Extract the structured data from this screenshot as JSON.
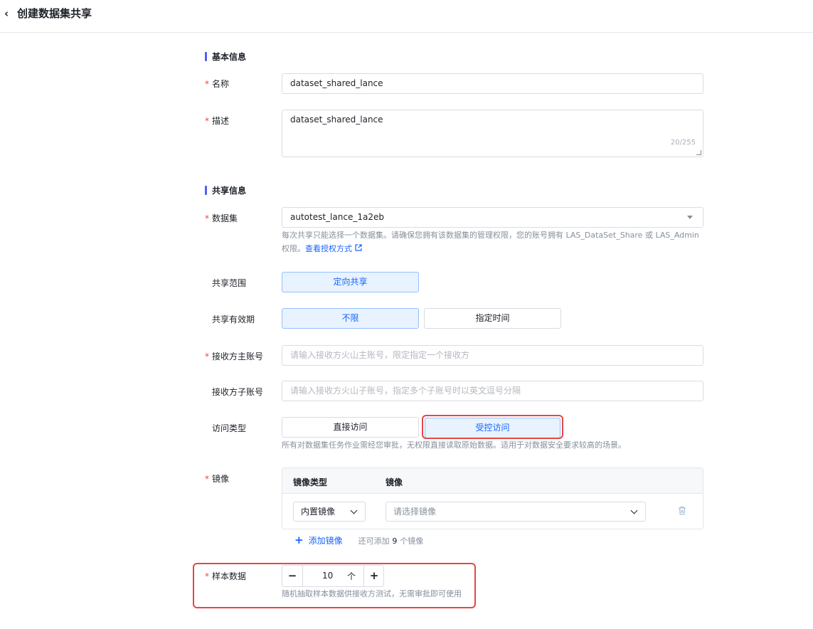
{
  "header": {
    "back_icon": "‹",
    "title": "创建数据集共享"
  },
  "sections": {
    "basic": "基本信息",
    "share": "共享信息"
  },
  "form": {
    "name": {
      "label": "名称",
      "value": "dataset_shared_lance"
    },
    "description": {
      "label": "描述",
      "value": "dataset_shared_lance",
      "counter": "20/255"
    },
    "dataset": {
      "label": "数据集",
      "value": "autotest_lance_1a2eb",
      "hint": "每次共享只能选择一个数据集。请确保您拥有该数据集的管理权限，您的账号拥有 LAS_DataSet_Share 或 LAS_Admin 权限。",
      "hint_link": "查看授权方式"
    },
    "share_scope": {
      "label": "共享范围",
      "option": "定向共享"
    },
    "validity": {
      "label": "共享有效期",
      "options": [
        "不限",
        "指定时间"
      ],
      "selected": "不限"
    },
    "main_account": {
      "label": "接收方主账号",
      "placeholder": "请输入接收方火山主账号，限定指定一个接收方"
    },
    "sub_account": {
      "label": "接收方子账号",
      "placeholder": "请输入接收方火山子账号，指定多个子账号时以英文逗号分隔"
    },
    "access_type": {
      "label": "访问类型",
      "options": [
        "直接访问",
        "受控访问"
      ],
      "selected": "受控访问",
      "hint": "所有对数据集任务作业需经您审批，无权限直接读取原始数据。适用于对数据安全要求较高的场景。"
    },
    "image": {
      "label": "镜像",
      "col_type": "镜像类型",
      "col_image": "镜像",
      "type_value": "内置镜像",
      "image_placeholder": "请选择镜像",
      "add_label": "添加镜像",
      "remaining_prefix": "还可添加",
      "remaining_count": "9",
      "remaining_suffix": "个镜像"
    },
    "sample": {
      "label": "样本数据",
      "value": "10",
      "unit": "个",
      "minus": "−",
      "plus": "+",
      "hint": "随机抽取样本数据供接收方测试，无需审批即可使用"
    }
  },
  "colors": {
    "accent": "#1664ff",
    "required": "#f53f3f",
    "highlight": "#e64646",
    "section_bar": "#4e5ff0"
  }
}
